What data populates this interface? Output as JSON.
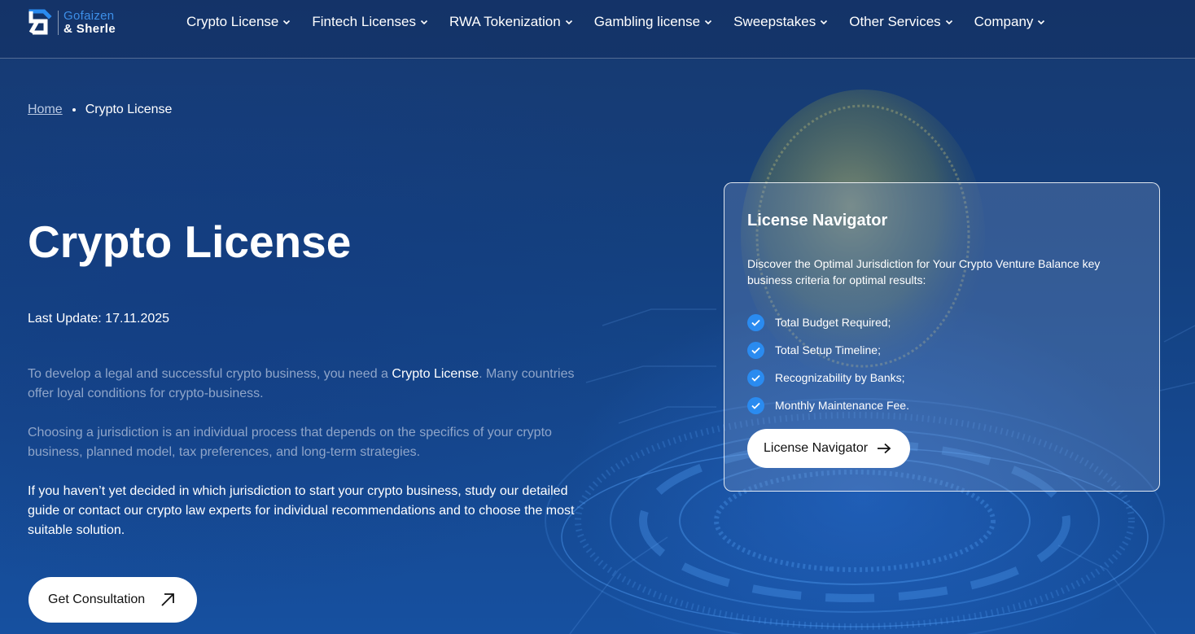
{
  "brand": {
    "name_line1": "Gofaizen",
    "name_line2": "& Sherle"
  },
  "nav": {
    "items": [
      {
        "label": "Crypto License"
      },
      {
        "label": "Fintech Licenses"
      },
      {
        "label": "RWA Tokenization"
      },
      {
        "label": "Gambling license"
      },
      {
        "label": "Sweepstakes"
      },
      {
        "label": "Other Services"
      },
      {
        "label": "Company"
      }
    ]
  },
  "breadcrumb": {
    "home": "Home",
    "current": "Crypto License"
  },
  "hero": {
    "title": "Crypto License",
    "last_update": "Last Update: 17.11.2025",
    "p1_before": "To develop a legal and successful crypto business, you need a ",
    "p1_highlight": "Crypto License",
    "p1_after": ". Many countries offer loyal conditions for crypto-business.",
    "p2": "Choosing a jurisdiction is an individual process that depends on the specifics of your crypto business, planned model, tax preferences, and long-term strategies.",
    "p3": "If you haven’t yet decided in which jurisdiction to start your crypto business, study our detailed guide or contact our crypto law experts for individual recommendations and to choose the most suitable solution.",
    "cta_label": "Get Consultation"
  },
  "navigator_card": {
    "title": "License Navigator",
    "description": "Discover the Optimal Jurisdiction for Your Crypto Venture Balance key business criteria for optimal results:",
    "items": [
      "Total Budget Required;",
      "Total Setup Timeline;",
      "Recognizability by Banks;",
      "Monthly Maintenance Fee."
    ],
    "button_label": "License Navigator"
  },
  "colors": {
    "accent": "#2a8bf0",
    "background": "#14407f",
    "muted_text": "#8fa5c9"
  },
  "icons": {
    "logo": "gofaizen-logo-icon",
    "nav_chevron": "chevron-down-icon",
    "check": "check-circle-icon",
    "cta_arrow": "arrow-up-right-icon",
    "navigator_arrow": "arrow-right-icon"
  }
}
